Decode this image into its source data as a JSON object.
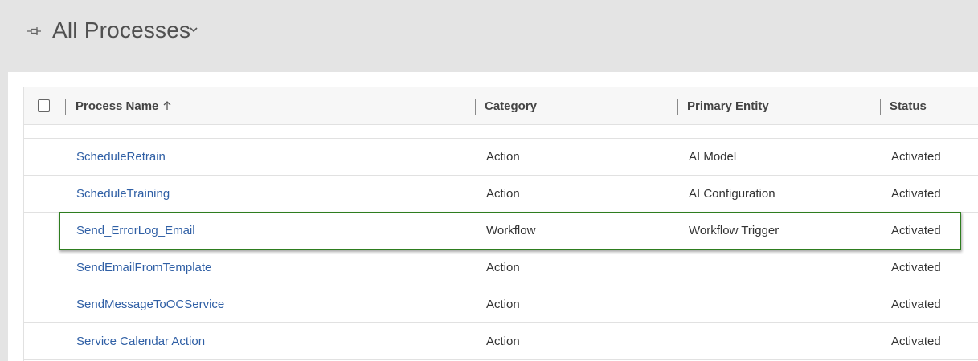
{
  "header": {
    "view_title": "All Processes"
  },
  "grid": {
    "columns": [
      {
        "label": "Process Name",
        "sorted": "ascending"
      },
      {
        "label": "Category"
      },
      {
        "label": "Primary Entity"
      },
      {
        "label": "Status"
      }
    ],
    "rows": [
      {
        "name": "ScheduleRetrain",
        "category": "Action",
        "entity": "AI Model",
        "status": "Activated"
      },
      {
        "name": "ScheduleTraining",
        "category": "Action",
        "entity": "AI Configuration",
        "status": "Activated"
      },
      {
        "name": "Send_ErrorLog_Email",
        "category": "Workflow",
        "entity": "Workflow Trigger",
        "status": "Activated",
        "highlighted": true
      },
      {
        "name": "SendEmailFromTemplate",
        "category": "Action",
        "entity": "",
        "status": "Activated"
      },
      {
        "name": "SendMessageToOCService",
        "category": "Action",
        "entity": "",
        "status": "Activated"
      },
      {
        "name": "Service Calendar Action",
        "category": "Action",
        "entity": "",
        "status": "Activated"
      }
    ]
  },
  "colors": {
    "link": "#2f5fa5",
    "highlight_border": "#2e7d1f",
    "header_bg": "#e4e4e4"
  },
  "icons": {
    "pin": "pin-icon",
    "view_selector": "chevron-down-icon",
    "sort": "arrow-up-icon"
  }
}
